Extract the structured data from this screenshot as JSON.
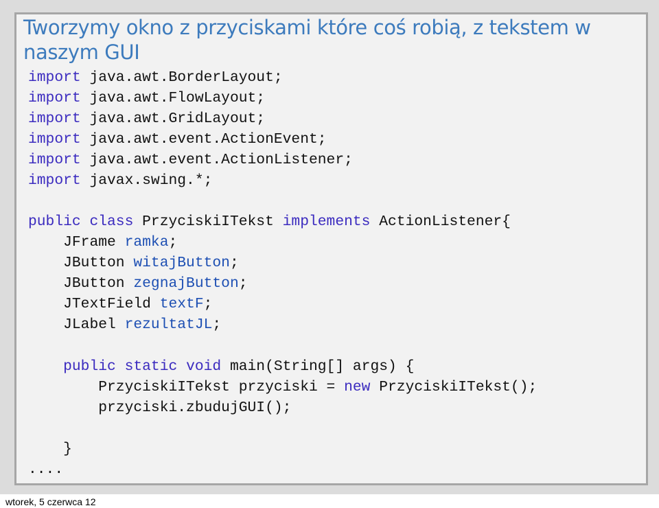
{
  "slide": {
    "title": "Tworzymy okno z przyciskami które coś robią, z tekstem w naszym GUI",
    "code": {
      "imports": [
        {
          "keyword": "import",
          "path": "java.awt.BorderLayout;"
        },
        {
          "keyword": "import",
          "path": "java.awt.FlowLayout;"
        },
        {
          "keyword": "import",
          "path": "java.awt.GridLayout;"
        },
        {
          "keyword": "import",
          "path": "java.awt.event.ActionEvent;"
        },
        {
          "keyword": "import",
          "path": "java.awt.event.ActionListener;"
        },
        {
          "keyword": "import",
          "path": "javax.swing.*;"
        }
      ],
      "class_decl": {
        "public": "public",
        "class": "class",
        "name": "PrzyciskiITekst",
        "implements": "implements",
        "interface": "ActionListener{"
      },
      "fields": [
        {
          "type": "JFrame",
          "name": "ramka",
          "end": ";"
        },
        {
          "type": "JButton",
          "name": "witajButton",
          "end": ";"
        },
        {
          "type": "JButton",
          "name": "zegnajButton",
          "end": ";"
        },
        {
          "type": "JTextField",
          "name": "textF",
          "end": ";"
        },
        {
          "type": "JLabel",
          "name": "rezultatJL",
          "end": ";"
        }
      ],
      "main_decl": {
        "public": "public",
        "static": "static",
        "void": "void",
        "signature": "main(String[] args) {"
      },
      "main_body": {
        "line1_before": "PrzyciskiITekst przyciski = ",
        "line1_new": "new",
        "line1_after": " PrzyciskiITekst();",
        "line2": "przyciski.zbudujGUI();"
      },
      "closing_brace": "}",
      "ellipsis": "...."
    }
  },
  "footer": {
    "date": "wtorek, 5 czerwca 12"
  },
  "colors": {
    "title": "#3d7bbd",
    "keyword": "#3b2bbf",
    "identifier": "#1d4fb3",
    "text": "#111111"
  }
}
